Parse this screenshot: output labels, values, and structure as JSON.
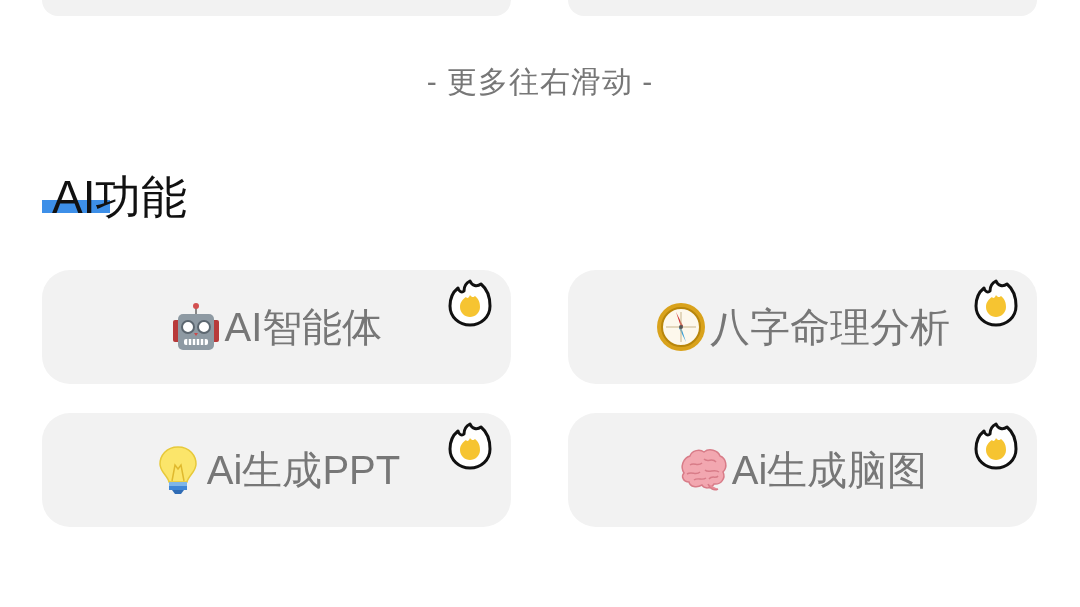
{
  "hint": "- 更多往右滑动 -",
  "section": {
    "title": "AI功能",
    "items": [
      {
        "label": "AI智能体",
        "hot": true
      },
      {
        "label": "八字命理分析",
        "hot": true
      },
      {
        "label": "Ai生成PPT",
        "hot": true
      },
      {
        "label": "Ai生成脑图",
        "hot": true
      }
    ]
  }
}
